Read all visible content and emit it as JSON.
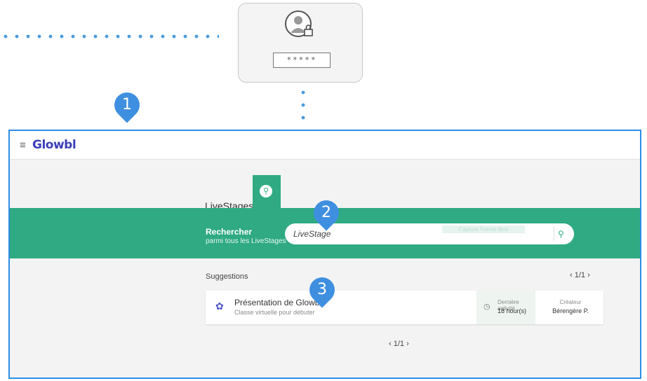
{
  "login": {
    "password_mask": "*****"
  },
  "markers": [
    "1",
    "2",
    "3"
  ],
  "app": {
    "logo": "Glowbl",
    "hamburger": "≡",
    "tab_label": "LiveStages",
    "search_tab_icon": "search-icon",
    "search": {
      "title": "Rechercher",
      "subtitle": "parmi tous les LiveStages",
      "value": "LiveStage",
      "faint_overlay": "Capture Forme libre",
      "button_icon": "search-icon"
    },
    "suggestions": {
      "title": "Suggestions",
      "pager_top": "1/1",
      "pager_bottom": "1/1",
      "items": [
        {
          "title": "Présentation de Glowbl",
          "subtitle": "Classe virtuelle pour débuter",
          "activity_label": "Dernière activité",
          "activity_value": "18 hour(s)",
          "creator_label": "Créateur",
          "creator_value": "Bérengère P."
        }
      ]
    }
  },
  "colors": {
    "accent_green": "#2faa83",
    "frame_blue": "#2f8de4",
    "marker_blue": "#3f8fe0",
    "logo_purple": "#3b3fb8"
  }
}
